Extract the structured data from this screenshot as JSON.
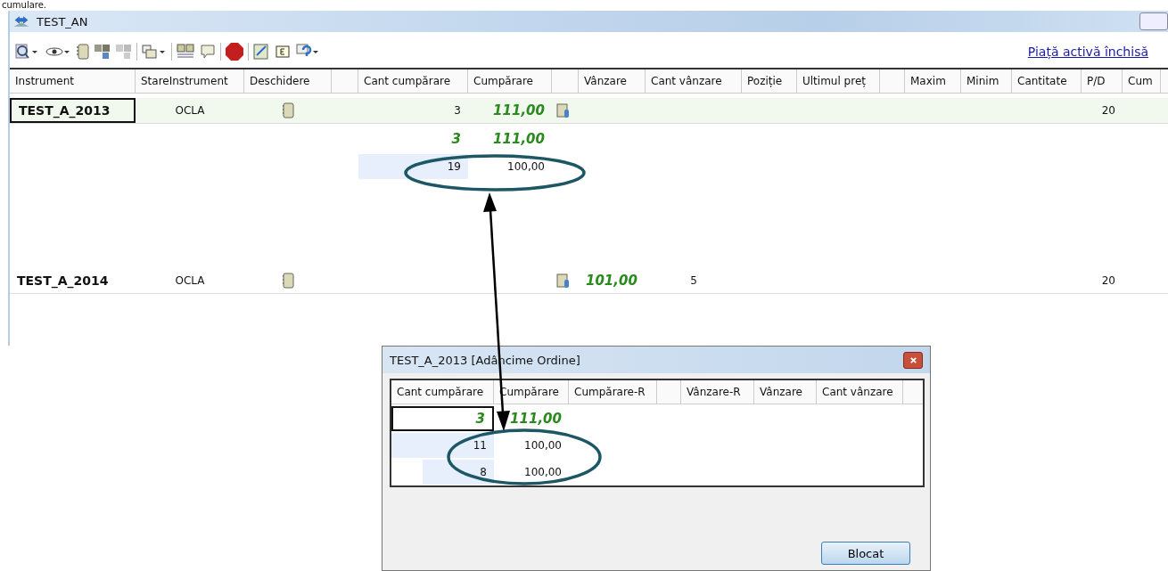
{
  "caption": "cumulare.",
  "window": {
    "title": "TEST_AN"
  },
  "toolbar": {
    "link": "Piață activă închisă"
  },
  "table": {
    "columns": [
      "Instrument",
      "StareInstrument",
      "Deschidere",
      "",
      "Cant cumpărare",
      "Cumpărare",
      "",
      "Vânzare",
      "Cant vânzare",
      "Poziție",
      "Ultimul preț",
      "",
      "Maxim",
      "Minim",
      "Cantitate",
      "P/D",
      "Cum"
    ],
    "rows": [
      {
        "kind": "instrument",
        "selected": true,
        "instrument": "TEST_A_2013",
        "state": "OCLA",
        "bid_qty": "3",
        "bid": "111,00",
        "qty_best": false,
        "price_best": true,
        "pd": "20"
      },
      {
        "kind": "depth",
        "bid_qty": "3",
        "bid": "111,00",
        "qty_best": true,
        "price_best": true
      },
      {
        "kind": "depth",
        "bid_qty": "19",
        "bid": "100,00",
        "qty_best": false,
        "price_best": false
      },
      {
        "kind": "instrument",
        "selected": false,
        "instrument": "TEST_A_2014",
        "state": "OCLA",
        "ask": "101,00",
        "ask_qty": "5",
        "qty_best": false,
        "price_best": true,
        "pd": "20"
      }
    ]
  },
  "dialog": {
    "title": "TEST_A_2013 [Adâncime Ordine]",
    "columns": [
      "Cant cumpărare",
      "Cumpărare",
      "Cumpărare-R",
      "",
      "Vânzare-R",
      "Vânzare",
      "Cant vânzare"
    ],
    "rows": [
      {
        "qty": "3",
        "price": "111,00",
        "best": true,
        "selected": true
      },
      {
        "qty": "11",
        "price": "100,00",
        "best": false,
        "selected": false
      },
      {
        "qty": "8",
        "price": "100,00",
        "best": false,
        "selected": false
      }
    ],
    "button": "Blocat"
  }
}
